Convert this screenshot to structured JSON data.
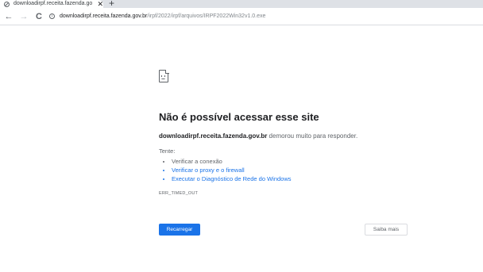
{
  "browser": {
    "tab": {
      "title": "downloadirpf.receita.fazenda.go",
      "close_glyph": "✕",
      "favicon": "globe-icon"
    },
    "new_tab_glyph": "+",
    "nav": {
      "back_glyph": "←",
      "forward_glyph": "→",
      "reload_glyph": "C"
    },
    "url": {
      "domain": "downloadirpf.receita.fazenda.gov.br",
      "path": "/irpf/2022/irpf/arquivos/IRPF2022Win32v1.0.exe"
    }
  },
  "error_page": {
    "title": "Não é possível acessar esse site",
    "description": {
      "host": "downloadirpf.receita.fazenda.gov.br",
      "message": " demorou muito para responder."
    },
    "try_label": "Tente:",
    "suggestions": [
      "Verificar a conexão",
      "Verificar o proxy e o firewall",
      "Executar o Diagnóstico de Rede do Windows"
    ],
    "error_code": "ERR_TIMED_OUT",
    "reload_label": "Recarregar",
    "more_label": "Saiba mais"
  },
  "colors": {
    "accent": "#1a73e8",
    "text": "#202124",
    "secondary_text": "#5f6368"
  }
}
